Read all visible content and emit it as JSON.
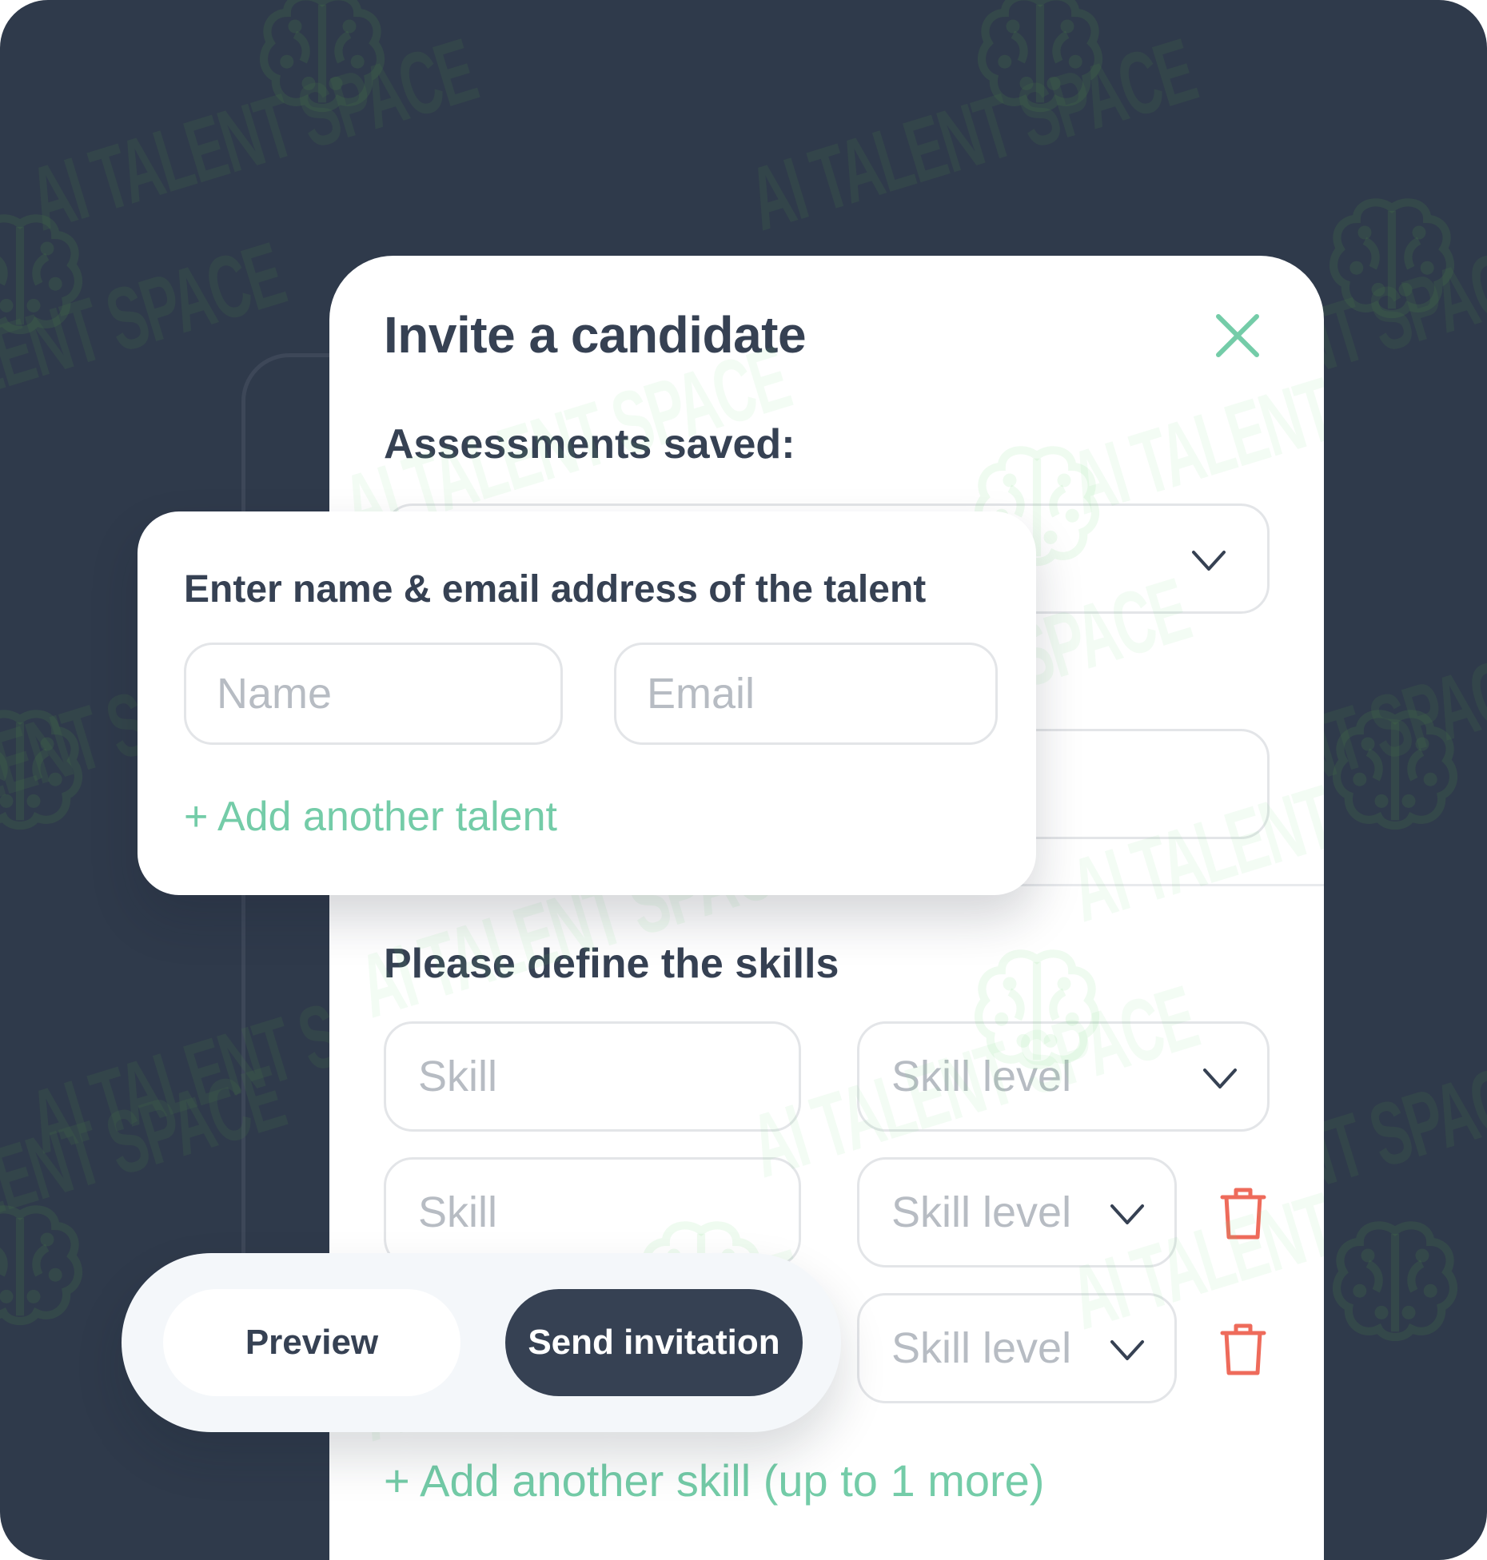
{
  "modal": {
    "title": "Invite a candidate",
    "assessments_heading": "Assessments saved:",
    "skills_heading": "Please define the skills",
    "skill_rows": [
      {
        "skill_placeholder": "Skill",
        "level_placeholder": "Skill level",
        "deletable": false
      },
      {
        "skill_placeholder": "Skill",
        "level_placeholder": "Skill level",
        "deletable": true
      },
      {
        "skill_placeholder": "",
        "level_placeholder": "Skill level",
        "deletable": true
      }
    ],
    "add_skill_link": "+ Add another skill (up to 1 more)"
  },
  "talent_card": {
    "title": "Enter name & email address of the talent",
    "name_placeholder": "Name",
    "email_placeholder": "Email",
    "add_talent_link": "+ Add another talent"
  },
  "actions": {
    "preview_label": "Preview",
    "send_label": "Send invitation"
  },
  "watermark": {
    "text": "AI TALENT SPACE"
  },
  "icons": {
    "close": "close-icon",
    "dropdown": "chevron-down-icon",
    "delete": "trash-icon",
    "watermark_logo": "brain-logo-icon"
  },
  "colors": {
    "background": "#2f3a4b",
    "text_primary": "#364153",
    "accent_green": "#74cca8",
    "danger": "#ee6b5b",
    "placeholder": "#b7bcc3",
    "send_button": "#364153"
  }
}
